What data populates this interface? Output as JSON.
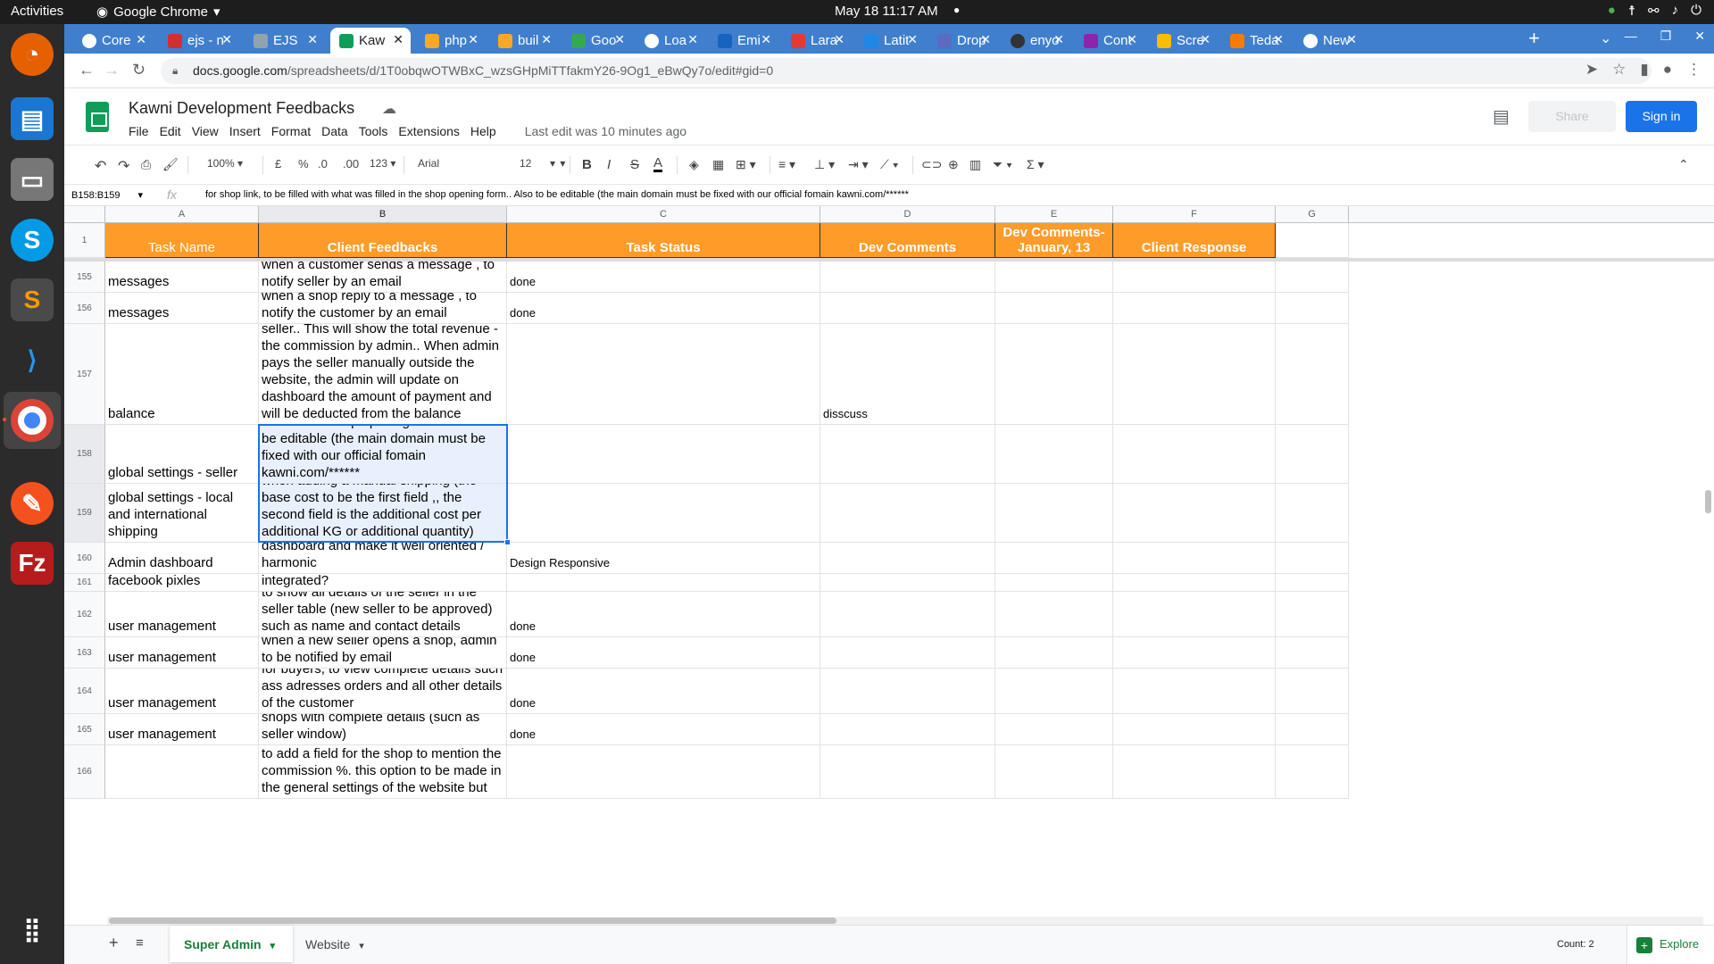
{
  "topbar": {
    "activities": "Activities",
    "app_name": "Google Chrome",
    "clock": "May 18  11:17 AM"
  },
  "browser": {
    "tabs": [
      {
        "label": "Core",
        "icon": "globe-icon",
        "color": "#ffffff"
      },
      {
        "label": "ejs - n",
        "icon": "red-square-icon",
        "color": "#d32f2f"
      },
      {
        "label": "EJS",
        "icon": "ejs-icon",
        "color": "#90a4ae"
      },
      {
        "label": "Kaw",
        "icon": "sheets-icon",
        "color": "#0f9d58"
      },
      {
        "label": "php",
        "icon": "chart-icon",
        "color": "#f9a825"
      },
      {
        "label": "buil",
        "icon": "chart-icon",
        "color": "#f9a825"
      },
      {
        "label": "Goo",
        "icon": "play-icon",
        "color": "#34a853"
      },
      {
        "label": "Loa",
        "icon": "google-icon",
        "color": "#ffffff"
      },
      {
        "label": "Emi",
        "icon": "mail-icon",
        "color": "#1565c0"
      },
      {
        "label": "Lara",
        "icon": "pin-icon",
        "color": "#e53935"
      },
      {
        "label": "Latit",
        "icon": "shield-icon",
        "color": "#1e88e5"
      },
      {
        "label": "Drop",
        "icon": "d-icon",
        "color": "#5c6bc0"
      },
      {
        "label": "enyo",
        "icon": "github-icon",
        "color": "#333333"
      },
      {
        "label": "Cont",
        "icon": "link-icon",
        "color": "#8e24aa"
      },
      {
        "label": "Scre",
        "icon": "drive-icon",
        "color": "#fbbc04"
      },
      {
        "label": "Teda",
        "icon": "tedai-icon",
        "color": "#f57c00"
      },
      {
        "label": "New",
        "icon": "globe-icon",
        "color": "#ffffff"
      }
    ],
    "url_host": "docs.google.com",
    "url_path": "/spreadsheets/d/1T0obqwOTWBxC_wzsGHpMiTTfakmY26-9Og1_eBwQy7o/edit#gid=0"
  },
  "sheets": {
    "title": "Kawni Development Feedbacks",
    "menu": [
      "File",
      "Edit",
      "View",
      "Insert",
      "Format",
      "Data",
      "Tools",
      "Extensions",
      "Help"
    ],
    "last_edit": "Last edit was 10 minutes ago",
    "share": "Share",
    "signin": "Sign in"
  },
  "format_bar": {
    "zoom": "100%",
    "currency": "£",
    "percent": "%",
    "dec_less": ".0",
    "dec_more": ".00",
    "number_format": "123",
    "font": "Arial",
    "font_size": "12"
  },
  "formula_bar": {
    "name_box": "B158:B159",
    "fx": "fx",
    "content": "for shop link, to be filled with what was filled in the shop opening form.. Also to be editable (the main domain must be fixed with our official fomain kawni.com/******"
  },
  "grid": {
    "column_letters": [
      "A",
      "B",
      "C",
      "D",
      "E",
      "F",
      "G"
    ],
    "header_row_number": "1",
    "headers": [
      "Task Name",
      "Client Feedbacks",
      "Task Status",
      "Dev Comments",
      "Dev Comments- January, 13",
      "Client Response",
      ""
    ],
    "rows": [
      {
        "num": "155",
        "a": "messages",
        "b": "when a customer sends a message , to notify seller by an email",
        "c": "done",
        "d": ""
      },
      {
        "num": "156",
        "a": "messages",
        "b": "when a shop reply to a message , to notify the customer by an email",
        "c": "done",
        "d": ""
      },
      {
        "num": "157",
        "a": "balance",
        "b": "to show the balance of payments to seller.. This will show the total revenue - the commission by admin.. When admin pays the seller manually outside the website, the admin will update on dashboard the amount of payment and will be deducted from the balance",
        "c": "",
        "d": "disscuss"
      },
      {
        "num": "158",
        "a": "global settings - seller",
        "b": "for shop link, to be filled with what was filled in the shop opening form.. Also to be editable (the main domain must be fixed with our official fomain kawni.com/******",
        "c": "",
        "d": ""
      },
      {
        "num": "159",
        "a": "global settings - local and international shipping",
        "b": "when adding a manual shipping (the base cost to be the first field ,, the second field is the additional cost per additional KG or additional quantity)",
        "c": "",
        "d": ""
      },
      {
        "num": "160",
        "a": "Admin dashboard",
        "b": "to modify the design on the main dashboard and make it well oriented / harmonic",
        "c": "Design Responsive",
        "d": ""
      },
      {
        "num": "161",
        "a": "facebook pixles",
        "b": "integrated?",
        "c": "",
        "d": ""
      },
      {
        "num": "162",
        "a": "user management",
        "b": "to show all details of the seller in the seller table (new seller to be approved) such as name and contact details",
        "c": "done",
        "d": ""
      },
      {
        "num": "163",
        "a": "user management",
        "b": "when a new seller opens a shop, admin to be notified by email",
        "c": "done",
        "d": ""
      },
      {
        "num": "164",
        "a": "user management",
        "b": "for buyers, to view complete details such ass adresses orders and all other details of the customer",
        "c": "done",
        "d": ""
      },
      {
        "num": "165",
        "a": "user management",
        "b": "on the dashboard, to view new tab for shops with complete details (such as seller window)",
        "c": "done",
        "d": ""
      },
      {
        "num": "166",
        "a": "",
        "b": "to add a field for the shop to mention the commission %. this option to be made in the general settings of the website but also to keep this option inside the sellers incase we want to",
        "c": "",
        "d": ""
      }
    ]
  },
  "sheet_tabs": {
    "active": "Super Admin",
    "other": "Website",
    "count": "Count: 2",
    "explore": "Explore"
  },
  "colors": {
    "header_orange": "#ff9b28",
    "selection_blue": "#1a73e8",
    "signin_blue": "#1a73e8",
    "sheets_green": "#0f9d58"
  }
}
